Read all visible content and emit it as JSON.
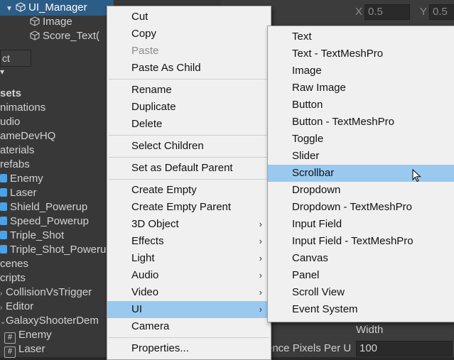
{
  "hierarchy": {
    "items": [
      {
        "label": "UI_Manager",
        "selected": true,
        "icon": "gameobject-cube-icon"
      },
      {
        "label": "Image",
        "selected": false,
        "icon": "gameobject-cube-icon"
      },
      {
        "label": "Score_Text(",
        "selected": false,
        "icon": "gameobject-cube-icon"
      }
    ]
  },
  "project": {
    "tab": "ct",
    "items": [
      {
        "label": "sets",
        "bold": true
      },
      {
        "label": "nimations"
      },
      {
        "label": "udio"
      },
      {
        "label": "ameDevHQ"
      },
      {
        "label": "aterials"
      },
      {
        "label": "refabs"
      },
      {
        "label": "Enemy",
        "icon": "prefab-icon"
      },
      {
        "label": "Laser",
        "icon": "prefab-icon"
      },
      {
        "label": "Shield_Powerup",
        "icon": "prefab-icon"
      },
      {
        "label": "Speed_Powerup",
        "icon": "prefab-icon"
      },
      {
        "label": "Triple_Shot",
        "icon": "prefab-icon"
      },
      {
        "label": "Triple_Shot_Poweru",
        "icon": "prefab-icon"
      },
      {
        "label": "cenes"
      },
      {
        "label": "cripts"
      },
      {
        "label": "CollisionVsTrigger",
        "arrow": true
      },
      {
        "label": "Editor",
        "arrow": true
      },
      {
        "label": "GalaxyShooterDem",
        "arrow": true
      },
      {
        "label": "Enemy",
        "icon": "script-hash-icon"
      },
      {
        "label": "Laser",
        "icon": "script-hash-icon"
      }
    ]
  },
  "inspector": {
    "x_label": "X",
    "x_value": "0.5",
    "y_label": "Y",
    "y_value": "0.5",
    "width_label": "Width",
    "ppu_label": "ence Pixels Per U",
    "ppu_value": "100"
  },
  "context_menu": {
    "items": [
      {
        "label": "Cut"
      },
      {
        "label": "Copy"
      },
      {
        "label": "Paste",
        "disabled": true
      },
      {
        "label": "Paste As Child"
      },
      {
        "separator": true
      },
      {
        "label": "Rename"
      },
      {
        "label": "Duplicate"
      },
      {
        "label": "Delete"
      },
      {
        "separator": true
      },
      {
        "label": "Select Children"
      },
      {
        "separator": true
      },
      {
        "label": "Set as Default Parent"
      },
      {
        "separator": true
      },
      {
        "label": "Create Empty"
      },
      {
        "label": "Create Empty Parent"
      },
      {
        "label": "3D Object",
        "submenu": true
      },
      {
        "label": "Effects",
        "submenu": true
      },
      {
        "label": "Light",
        "submenu": true
      },
      {
        "label": "Audio",
        "submenu": true
      },
      {
        "label": "Video",
        "submenu": true
      },
      {
        "label": "UI",
        "submenu": true,
        "highlighted": true
      },
      {
        "label": "Camera"
      },
      {
        "separator": true
      },
      {
        "label": "Properties..."
      }
    ]
  },
  "ui_submenu": {
    "items": [
      {
        "label": "Text"
      },
      {
        "label": "Text - TextMeshPro"
      },
      {
        "label": "Image"
      },
      {
        "label": "Raw Image"
      },
      {
        "label": "Button"
      },
      {
        "label": "Button - TextMeshPro"
      },
      {
        "label": "Toggle"
      },
      {
        "label": "Slider"
      },
      {
        "label": "Scrollbar",
        "highlighted": true
      },
      {
        "label": "Dropdown"
      },
      {
        "label": "Dropdown - TextMeshPro"
      },
      {
        "label": "Input Field"
      },
      {
        "label": "Input Field - TextMeshPro"
      },
      {
        "label": "Canvas"
      },
      {
        "label": "Panel"
      },
      {
        "label": "Scroll View"
      },
      {
        "label": "Event System"
      }
    ]
  },
  "colors": {
    "menu_bg": "#f0f0f0",
    "highlight": "#99c9ef",
    "selection": "#2c5d87",
    "prefab_blue": "#4aa3e8"
  }
}
